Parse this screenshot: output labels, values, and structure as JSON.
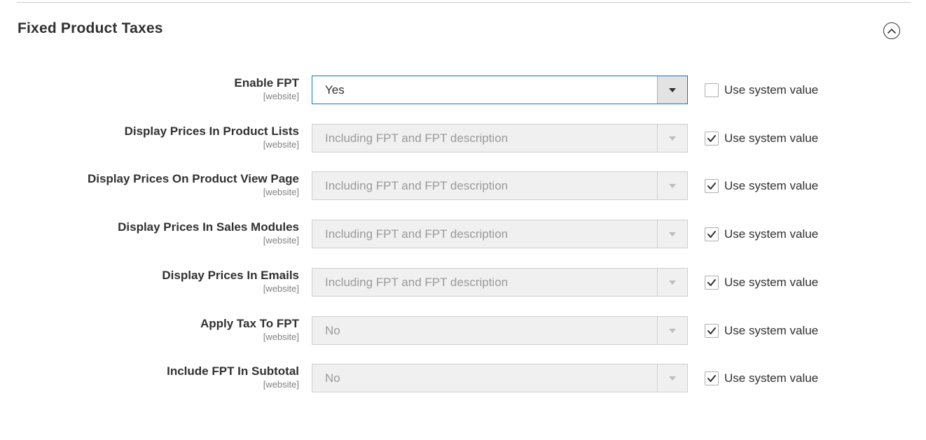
{
  "section": {
    "title": "Fixed Product Taxes"
  },
  "fields": [
    {
      "label": "Enable FPT",
      "scope": "[website]",
      "value": "Yes",
      "use_system_value_label": "Use system value",
      "use_system_value_checked": false,
      "disabled": false
    },
    {
      "label": "Display Prices In Product Lists",
      "scope": "[website]",
      "value": "Including FPT and FPT description",
      "use_system_value_label": "Use system value",
      "use_system_value_checked": true,
      "disabled": true
    },
    {
      "label": "Display Prices On Product View Page",
      "scope": "[website]",
      "value": "Including FPT and FPT description",
      "use_system_value_label": "Use system value",
      "use_system_value_checked": true,
      "disabled": true
    },
    {
      "label": "Display Prices In Sales Modules",
      "scope": "[website]",
      "value": "Including FPT and FPT description",
      "use_system_value_label": "Use system value",
      "use_system_value_checked": true,
      "disabled": true
    },
    {
      "label": "Display Prices In Emails",
      "scope": "[website]",
      "value": "Including FPT and FPT description",
      "use_system_value_label": "Use system value",
      "use_system_value_checked": true,
      "disabled": true
    },
    {
      "label": "Apply Tax To FPT",
      "scope": "[website]",
      "value": "No",
      "use_system_value_label": "Use system value",
      "use_system_value_checked": true,
      "disabled": true
    },
    {
      "label": "Include FPT In Subtotal",
      "scope": "[website]",
      "value": "No",
      "use_system_value_label": "Use system value",
      "use_system_value_checked": true,
      "disabled": true
    }
  ],
  "icons": {
    "collapse": "chevron-up-circle-icon",
    "dropdown": "caret-down-icon",
    "check": "checkmark-icon"
  },
  "colors": {
    "active_border": "#007bdb",
    "disabled_bg": "#f0f0f0",
    "text": "#303030",
    "scope_text": "#808080"
  }
}
